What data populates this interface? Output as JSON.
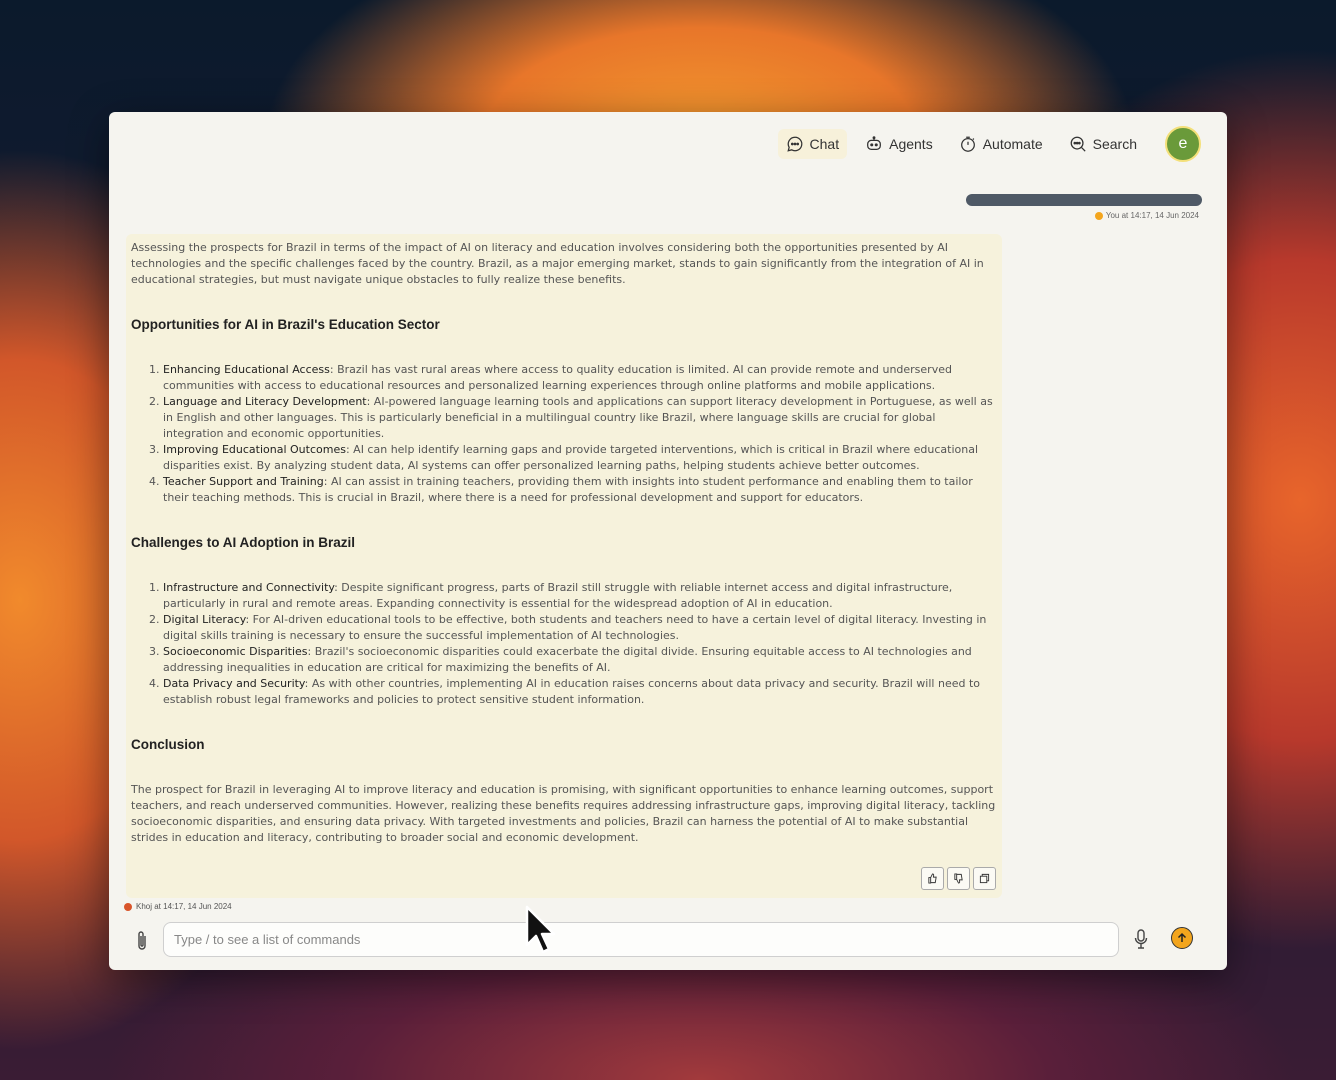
{
  "nav": {
    "items": [
      {
        "label": "Chat",
        "icon": "chat-icon",
        "active": true
      },
      {
        "label": "Agents",
        "icon": "robot-icon",
        "active": false
      },
      {
        "label": "Automate",
        "icon": "timer-icon",
        "active": false
      },
      {
        "label": "Search",
        "icon": "search-icon",
        "active": false
      }
    ],
    "avatar_letter": "e"
  },
  "user_message": {
    "meta": "You at 14:17, 14 Jun 2024"
  },
  "answer": {
    "intro": "Assessing the prospects for Brazil in terms of the impact of AI on literacy and education involves considering both the opportunities presented by AI technologies and the specific challenges faced by the country. Brazil, as a major emerging market, stands to gain significantly from the integration of AI in educational strategies, but must navigate unique obstacles to fully realize these benefits.",
    "section1": {
      "heading": "Opportunities for AI in Brazil's Education Sector",
      "items": [
        {
          "title": "Enhancing Educational Access",
          "text": ": Brazil has vast rural areas where access to quality education is limited. AI can provide remote and underserved communities with access to educational resources and personalized learning experiences through online platforms and mobile applications."
        },
        {
          "title": "Language and Literacy Development",
          "text": ": AI-powered language learning tools and applications can support literacy development in Portuguese, as well as in English and other languages. This is particularly beneficial in a multilingual country like Brazil, where language skills are crucial for global integration and economic opportunities."
        },
        {
          "title": "Improving Educational Outcomes",
          "text": ": AI can help identify learning gaps and provide targeted interventions, which is critical in Brazil where educational disparities exist. By analyzing student data, AI systems can offer personalized learning paths, helping students achieve better outcomes."
        },
        {
          "title": "Teacher Support and Training",
          "text": ": AI can assist in training teachers, providing them with insights into student performance and enabling them to tailor their teaching methods. This is crucial in Brazil, where there is a need for professional development and support for educators."
        }
      ]
    },
    "section2": {
      "heading": "Challenges to AI Adoption in Brazil",
      "items": [
        {
          "title": "Infrastructure and Connectivity",
          "text": ": Despite significant progress, parts of Brazil still struggle with reliable internet access and digital infrastructure, particularly in rural and remote areas. Expanding connectivity is essential for the widespread adoption of AI in education."
        },
        {
          "title": "Digital Literacy",
          "text": ": For AI-driven educational tools to be effective, both students and teachers need to have a certain level of digital literacy. Investing in digital skills training is necessary to ensure the successful implementation of AI technologies."
        },
        {
          "title": "Socioeconomic Disparities",
          "text": ": Brazil's socioeconomic disparities could exacerbate the digital divide. Ensuring equitable access to AI technologies and addressing inequalities in education are critical for maximizing the benefits of AI."
        },
        {
          "title": "Data Privacy and Security",
          "text": ": As with other countries, implementing AI in education raises concerns about data privacy and security. Brazil will need to establish robust legal frameworks and policies to protect sensitive student information."
        }
      ]
    },
    "section3": {
      "heading": "Conclusion",
      "text": "The prospect for Brazil in leveraging AI to improve literacy and education is promising, with significant opportunities to enhance learning outcomes, support teachers, and reach underserved communities. However, realizing these benefits requires addressing infrastructure gaps, improving digital literacy, tackling socioeconomic disparities, and ensuring data privacy. With targeted investments and policies, Brazil can harness the potential of AI to make substantial strides in education and literacy, contributing to broader social and economic development."
    },
    "meta": "Khoj at 14:17, 14 Jun 2024"
  },
  "composer": {
    "placeholder": "Type / to see a list of commands"
  },
  "colors": {
    "accent": "#f3a51d",
    "answer_bg": "#f6f2dc",
    "avatar_bg": "#6a9a3a"
  }
}
